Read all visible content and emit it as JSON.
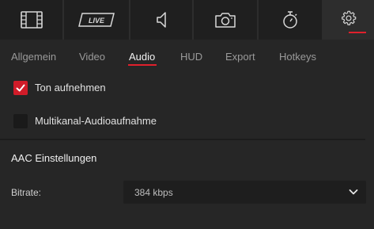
{
  "toolbar": {
    "buttons": [
      {
        "icon": "film-icon"
      },
      {
        "icon": "live-icon",
        "label": "LIVE"
      },
      {
        "icon": "speaker-icon"
      },
      {
        "icon": "camera-icon"
      },
      {
        "icon": "stopwatch-icon"
      },
      {
        "icon": "gear-icon",
        "active": true
      }
    ]
  },
  "tabs": [
    {
      "label": "Allgemein"
    },
    {
      "label": "Video"
    },
    {
      "label": "Audio",
      "active": true
    },
    {
      "label": "HUD"
    },
    {
      "label": "Export"
    },
    {
      "label": "Hotkeys"
    }
  ],
  "options": {
    "record_sound": {
      "label": "Ton aufnehmen",
      "checked": true
    },
    "multichannel": {
      "label": "Multikanal-Audioaufnahme",
      "checked": false
    }
  },
  "aac": {
    "title": "AAC Einstellungen",
    "bitrate_label": "Bitrate:",
    "bitrate_value": "384 kbps"
  },
  "colors": {
    "accent": "#e0202c",
    "background": "#262626",
    "toolbar_button": "#1f1f1f"
  }
}
